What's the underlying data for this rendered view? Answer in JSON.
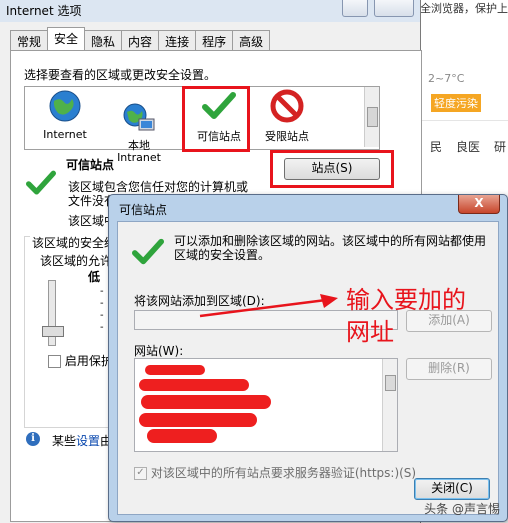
{
  "background": {
    "top_text": "全浏览器，保护上",
    "weather": "2~7°C",
    "air_quality": "轻度污染",
    "cells": [
      "民",
      "良医",
      "研"
    ],
    "colors": {
      "air_quality_bg": "#f5a623"
    }
  },
  "internet_options": {
    "title": "Internet 选项",
    "tabs": [
      "常规",
      "安全",
      "隐私",
      "内容",
      "连接",
      "程序",
      "高级"
    ],
    "active_tab": "安全",
    "zone_prompt": "选择要查看的区域或更改安全设置。",
    "zones": [
      {
        "label": "Internet",
        "icon": "globe-icon"
      },
      {
        "label": "本地\nIntranet",
        "icon": "intranet-icon"
      },
      {
        "label": "可信站点",
        "icon": "checkmark-icon"
      },
      {
        "label": "受限站点",
        "icon": "restricted-icon"
      }
    ],
    "zone_title": "可信站点",
    "zone_desc_1": "该区域包含您信任对您的计算机或",
    "zone_desc_2": "文件没有",
    "zone_desc_3": "该区域中",
    "sites_button": "站点(S)",
    "security_level_group": "该区域的安全级",
    "allowed_levels": "该区域的允许",
    "level_label": "低",
    "level_dashes": [
      "-",
      "-",
      "-",
      "-"
    ],
    "protected_mode": "启用保护",
    "info_text_prefix": "某些",
    "info_link": "设置",
    "info_text_suffix": "由"
  },
  "trusted_sites": {
    "title": "可信站点",
    "close_symbol": "X",
    "description": "可以添加和删除该区域的网站。该区域中的所有网站都使用区域的安全设置。",
    "add_label": "将该网站添加到区域(D):",
    "add_value": "",
    "add_button": "添加(A)",
    "sites_label": "网站(W):",
    "sites_entries": [],
    "remove_button": "删除(R)",
    "https_checkbox": "对该区域中的所有站点要求服务器验证(https:)(S)",
    "https_checked": true,
    "close_button": "关闭(C)"
  },
  "annotation": {
    "text_line1": "输入要加的",
    "text_line2": "网址",
    "color": "#e8141c"
  },
  "watermark": "头条 @声言惕"
}
